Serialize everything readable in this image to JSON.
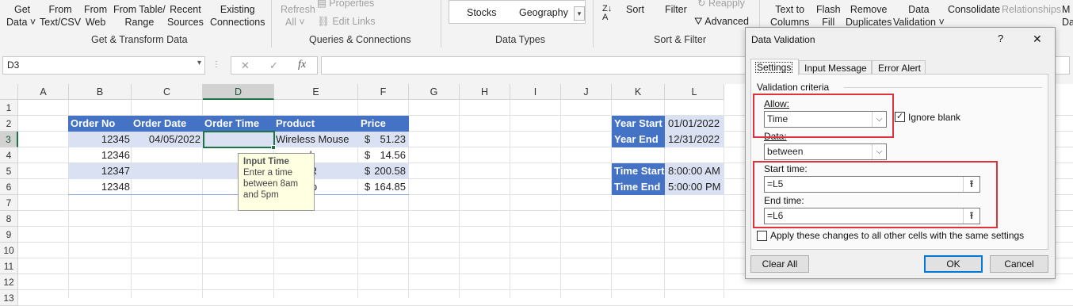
{
  "ribbon": {
    "get_data": [
      "Get",
      "Data ˅"
    ],
    "from_text_csv": [
      "From",
      "Text/CSV"
    ],
    "from_web": [
      "From",
      "Web"
    ],
    "from_table": [
      "From Table/",
      "Range"
    ],
    "recent_sources": [
      "Recent",
      "Sources"
    ],
    "existing_connections": [
      "Existing",
      "Connections"
    ],
    "refresh_all": [
      "Refresh",
      "All ˅"
    ],
    "properties": "Properties",
    "edit_links": "Edit Links",
    "stocks": "Stocks",
    "geography": "Geography",
    "sort": "Sort",
    "filter": "Filter",
    "reapply": "Reapply",
    "advanced": "Advanced",
    "text_to_columns": [
      "Text to",
      "Columns"
    ],
    "flash_fill": [
      "Flash",
      "Fill"
    ],
    "remove_duplicates": [
      "Remove",
      "Duplicates"
    ],
    "data_validation": [
      "Data",
      "Validation ˅"
    ],
    "consolidate": "Consolidate",
    "relationships": "Relationships",
    "manage": [
      "M",
      "Da"
    ],
    "groups": {
      "get_transform": "Get & Transform Data",
      "queries": "Queries & Connections",
      "data_types": "Data Types",
      "sort_filter": "Sort & Filter"
    }
  },
  "formula_bar": {
    "name_box": "D3",
    "fx": "fx",
    "value": ""
  },
  "columns": [
    "A",
    "B",
    "C",
    "D",
    "E",
    "F",
    "G",
    "H",
    "I",
    "J",
    "K",
    "L"
  ],
  "rows": [
    "1",
    "2",
    "3",
    "4",
    "5",
    "6",
    "7",
    "8",
    "9",
    "10",
    "11",
    "12",
    "13"
  ],
  "table": {
    "headers": [
      "Order No",
      "Order Date",
      "Order Time",
      "Product",
      "Price"
    ],
    "rows": [
      {
        "order_no": "12345",
        "order_date": "04/05/2022",
        "product": "Wireless Mouse",
        "price_sym": "$",
        "price": "51.23"
      },
      {
        "order_no": "12346",
        "order_date": "",
        "product": "rd",
        "price_sym": "$",
        "price": "14.56"
      },
      {
        "order_no": "12347",
        "order_date": "",
        "product": "XR",
        "price_sym": "$",
        "price": "200.58"
      },
      {
        "order_no": "12348",
        "order_date": "",
        "product": "top",
        "price_sym": "$",
        "price": "164.85"
      }
    ]
  },
  "side_table": {
    "year_start_label": "Year Start",
    "year_start": "01/01/2022",
    "year_end_label": "Year End",
    "year_end": "12/31/2022",
    "time_start_label": "Time Start",
    "time_start": "8:00:00 AM",
    "time_end_label": "Time End",
    "time_end": "5:00:00 PM"
  },
  "tooltip": {
    "title": "Input Time",
    "lines": [
      "Enter a time",
      "between 8am",
      "and 5pm"
    ]
  },
  "dialog": {
    "title": "Data Validation",
    "help": "?",
    "close": "✕",
    "tabs": [
      "Settings",
      "Input Message",
      "Error Alert"
    ],
    "section": "Validation criteria",
    "allow_label": "Allow:",
    "allow_value": "Time",
    "ignore_blank": "Ignore blank",
    "data_label": "Data:",
    "data_value": "between",
    "start_label": "Start time:",
    "start_value": "=L5",
    "end_label": "End time:",
    "end_value": "=L6",
    "apply_all": "Apply these changes to all other cells with the same settings",
    "clear_all": "Clear All",
    "ok": "OK",
    "cancel": "Cancel",
    "ignore_blank_checked": true,
    "apply_all_checked": false
  },
  "colors": {
    "header_blue": "#4472c4",
    "band_blue": "#d9e1f2",
    "highlight_red": "#e0323a",
    "ok_border": "#0078d7"
  }
}
